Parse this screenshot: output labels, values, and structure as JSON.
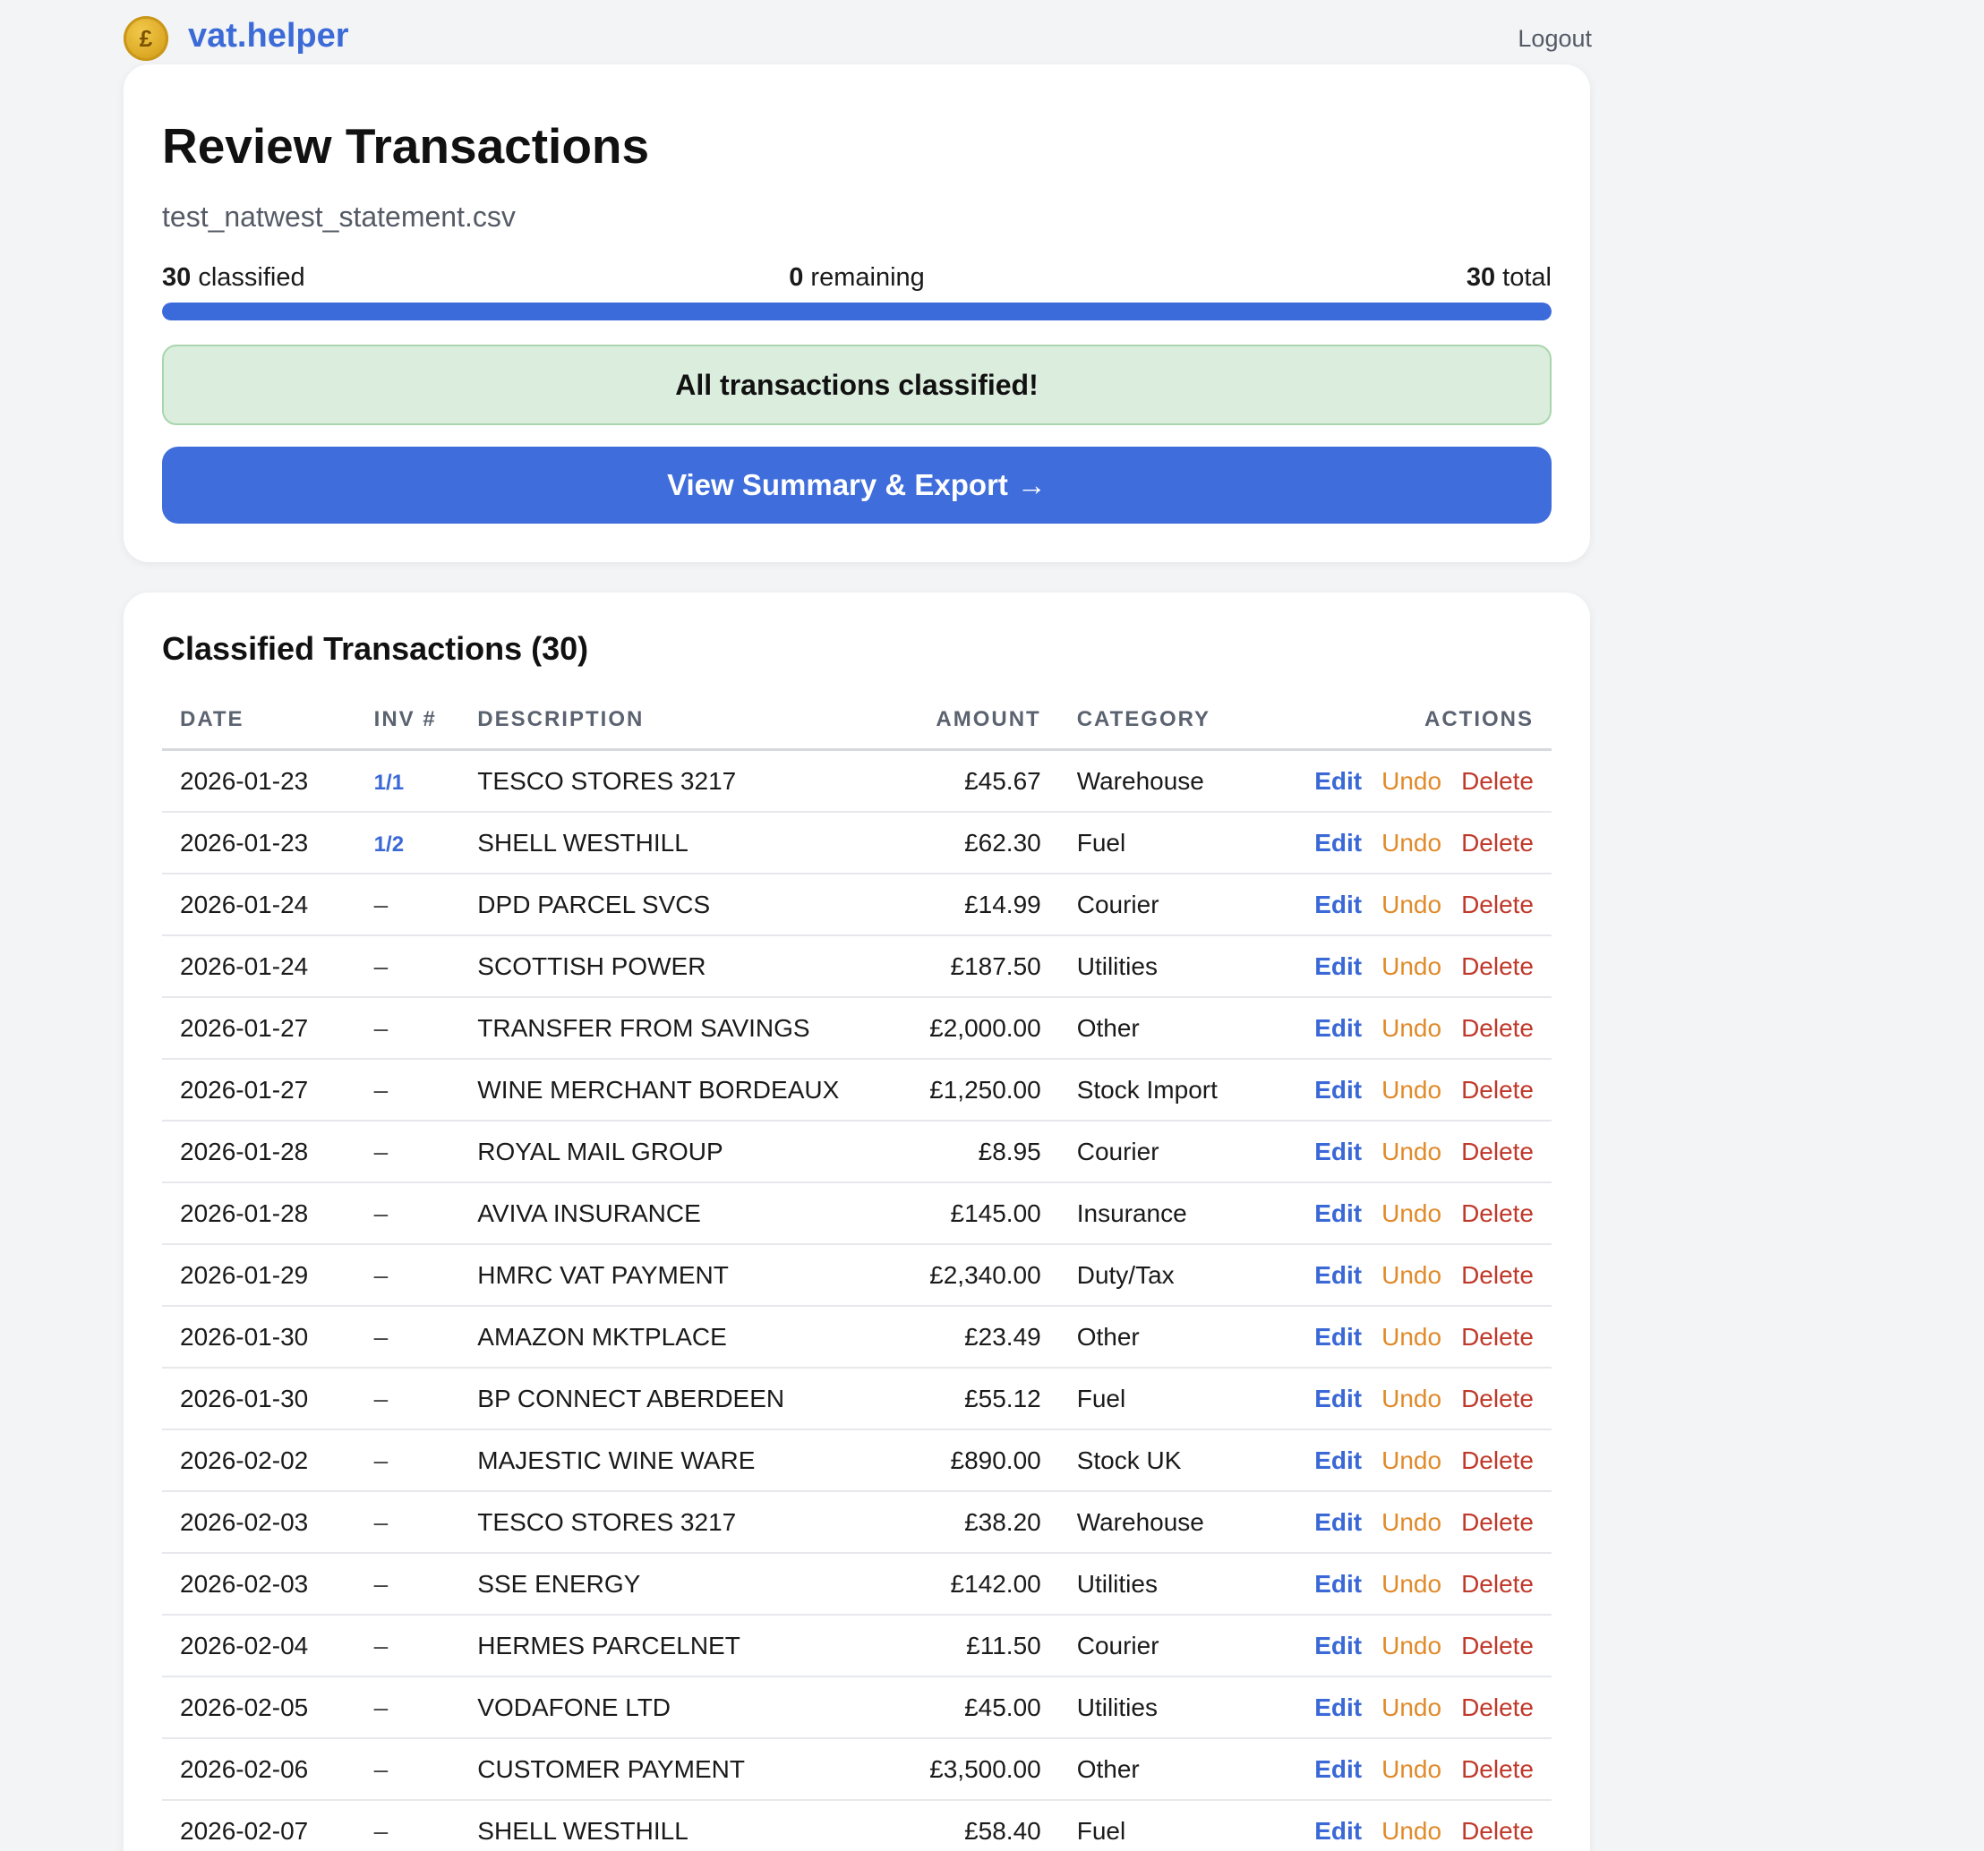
{
  "app": {
    "brand": "vat.helper",
    "logo_symbol": "£",
    "logout_label": "Logout"
  },
  "review": {
    "title": "Review Transactions",
    "file_name": "test_natwest_statement.csv",
    "classified_count": "30",
    "classified_label": " classified",
    "remaining_count": "0",
    "remaining_label": " remaining",
    "total_count": "30",
    "total_label": " total",
    "progress_fraction": 1.0,
    "success_message": "All transactions classified!",
    "cta_label": "View Summary & Export",
    "cta_arrow": "→"
  },
  "table": {
    "title": "Classified Transactions (30)",
    "columns": {
      "date": "DATE",
      "inv": "INV #",
      "description": "DESCRIPTION",
      "amount": "AMOUNT",
      "category": "CATEGORY",
      "actions": "ACTIONS"
    },
    "action_labels": {
      "edit": "Edit",
      "undo": "Undo",
      "delete": "Delete"
    },
    "rows": [
      {
        "date": "2026-01-23",
        "inv": "1/1",
        "description": "TESCO STORES 3217",
        "amount": "£45.67",
        "sign": "neg",
        "category": "Warehouse"
      },
      {
        "date": "2026-01-23",
        "inv": "1/2",
        "description": "SHELL WESTHILL",
        "amount": "£62.30",
        "sign": "neg",
        "category": "Fuel"
      },
      {
        "date": "2026-01-24",
        "inv": "–",
        "description": "DPD PARCEL SVCS",
        "amount": "£14.99",
        "sign": "neg",
        "category": "Courier"
      },
      {
        "date": "2026-01-24",
        "inv": "–",
        "description": "SCOTTISH POWER",
        "amount": "£187.50",
        "sign": "neg",
        "category": "Utilities"
      },
      {
        "date": "2026-01-27",
        "inv": "–",
        "description": "TRANSFER FROM SAVINGS",
        "amount": "£2,000.00",
        "sign": "pos",
        "category": "Other"
      },
      {
        "date": "2026-01-27",
        "inv": "–",
        "description": "WINE MERCHANT BORDEAUX",
        "amount": "£1,250.00",
        "sign": "neg",
        "category": "Stock Import"
      },
      {
        "date": "2026-01-28",
        "inv": "–",
        "description": "ROYAL MAIL GROUP",
        "amount": "£8.95",
        "sign": "neg",
        "category": "Courier"
      },
      {
        "date": "2026-01-28",
        "inv": "–",
        "description": "AVIVA INSURANCE",
        "amount": "£145.00",
        "sign": "neg",
        "category": "Insurance"
      },
      {
        "date": "2026-01-29",
        "inv": "–",
        "description": "HMRC VAT PAYMENT",
        "amount": "£2,340.00",
        "sign": "neg",
        "category": "Duty/Tax"
      },
      {
        "date": "2026-01-30",
        "inv": "–",
        "description": "AMAZON MKTPLACE",
        "amount": "£23.49",
        "sign": "neg",
        "category": "Other"
      },
      {
        "date": "2026-01-30",
        "inv": "–",
        "description": "BP CONNECT ABERDEEN",
        "amount": "£55.12",
        "sign": "neg",
        "category": "Fuel"
      },
      {
        "date": "2026-02-02",
        "inv": "–",
        "description": "MAJESTIC WINE WARE",
        "amount": "£890.00",
        "sign": "neg",
        "category": "Stock UK"
      },
      {
        "date": "2026-02-03",
        "inv": "–",
        "description": "TESCO STORES 3217",
        "amount": "£38.20",
        "sign": "neg",
        "category": "Warehouse"
      },
      {
        "date": "2026-02-03",
        "inv": "–",
        "description": "SSE ENERGY",
        "amount": "£142.00",
        "sign": "neg",
        "category": "Utilities"
      },
      {
        "date": "2026-02-04",
        "inv": "–",
        "description": "HERMES PARCELNET",
        "amount": "£11.50",
        "sign": "neg",
        "category": "Courier"
      },
      {
        "date": "2026-02-05",
        "inv": "–",
        "description": "VODAFONE LTD",
        "amount": "£45.00",
        "sign": "neg",
        "category": "Utilities"
      },
      {
        "date": "2026-02-06",
        "inv": "–",
        "description": "CUSTOMER PAYMENT",
        "amount": "£3,500.00",
        "sign": "pos",
        "category": "Other"
      },
      {
        "date": "2026-02-07",
        "inv": "–",
        "description": "SHELL WESTHILL",
        "amount": "£58.40",
        "sign": "neg",
        "category": "Fuel"
      }
    ]
  },
  "colors": {
    "brand_blue": "#3c6bd8",
    "negative_amount": "#c0392b",
    "positive_amount": "#3a9e4a",
    "undo_orange": "#e08a2a",
    "success_bg": "#dbeddd"
  }
}
